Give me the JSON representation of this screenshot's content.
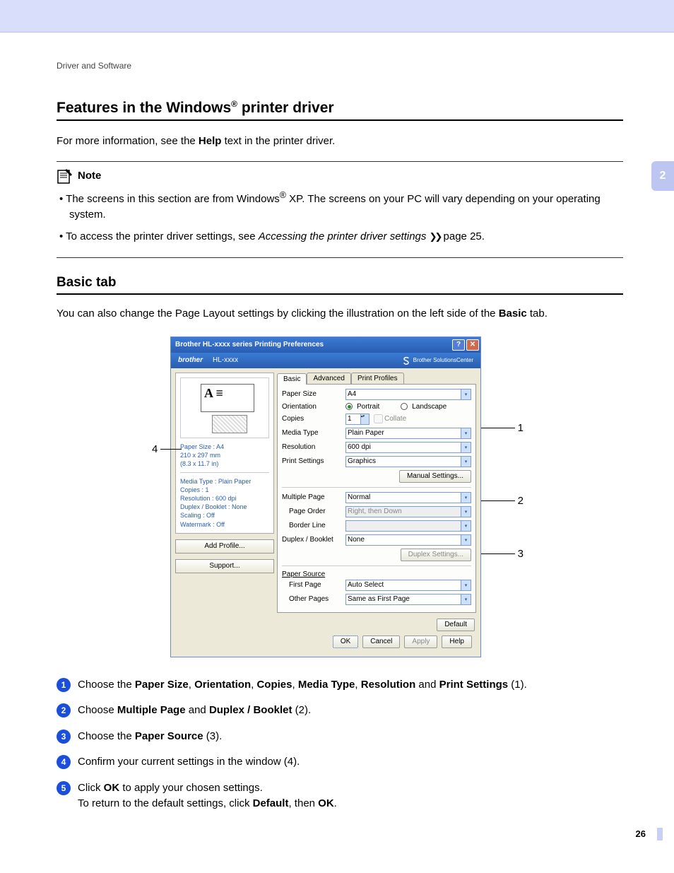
{
  "chapter_tab": "2",
  "breadcrumb": "Driver and Software",
  "heading": "Features in the Windows® printer driver",
  "intro_prefix": "For more information, see the ",
  "intro_bold": "Help",
  "intro_suffix": " text in the printer driver.",
  "note_label": "Note",
  "note1_a": "The screens in this section are from Windows",
  "note1_b": " XP. The screens on your PC will vary depending on your operating system.",
  "note2_a": "To access the printer driver settings, see ",
  "note2_italic": "Accessing the printer driver settings",
  "note2_b": " page 25.",
  "subheading": "Basic tab",
  "sub_intro_a": "You can also change the Page Layout settings by clicking the illustration on the left side of the ",
  "sub_intro_bold": "Basic",
  "sub_intro_b": " tab.",
  "dialog": {
    "title": "Brother HL-xxxx series Printing Preferences",
    "brand": "brother",
    "model": "HL-xxxx",
    "solutions": "Brother SolutionsCenter",
    "tabs": {
      "basic": "Basic",
      "advanced": "Advanced",
      "profiles": "Print Profiles"
    },
    "labels": {
      "paper_size": "Paper Size",
      "orientation": "Orientation",
      "copies": "Copies",
      "media_type": "Media Type",
      "resolution": "Resolution",
      "print_settings": "Print Settings",
      "multiple_page": "Multiple Page",
      "page_order": "Page Order",
      "border_line": "Border Line",
      "duplex_booklet": "Duplex / Booklet",
      "paper_source": "Paper Source",
      "first_page": "First Page",
      "other_pages": "Other Pages"
    },
    "values": {
      "paper_size": "A4",
      "portrait": "Portrait",
      "landscape": "Landscape",
      "copies": "1",
      "collate": "Collate",
      "media_type": "Plain Paper",
      "resolution": "600 dpi",
      "print_settings": "Graphics",
      "multiple_page": "Normal",
      "page_order": "Right, then Down",
      "duplex_booklet": "None",
      "first_page": "Auto Select",
      "other_pages": "Same as First Page"
    },
    "buttons": {
      "manual_settings": "Manual Settings...",
      "duplex_settings": "Duplex Settings...",
      "default": "Default",
      "add_profile": "Add Profile...",
      "support": "Support...",
      "ok": "OK",
      "cancel": "Cancel",
      "apply": "Apply",
      "help": "Help"
    },
    "summary": {
      "l1": "Paper Size : A4",
      "l2": "210 x 297 mm",
      "l3": "(8.3 x 11.7 in)",
      "l4": "Media Type : Plain Paper",
      "l5": "Copies : 1",
      "l6": "Resolution : 600 dpi",
      "l7": "Duplex / Booklet : None",
      "l8": "Scaling : Off",
      "l9": "Watermark : Off"
    }
  },
  "callouts": {
    "c1": "1",
    "c2": "2",
    "c3": "3",
    "c4": "4"
  },
  "steps": {
    "s1": "Choose the <b>Paper Size</b>, <b>Orientation</b>, <b>Copies</b>, <b>Media Type</b>, <b>Resolution</b> and <b>Print Settings</b> (1).",
    "s2": "Choose <b>Multiple Page</b> and <b>Duplex / Booklet</b> (2).",
    "s3": "Choose the <b>Paper Source</b> (3).",
    "s4": "Confirm your current settings in the window (4).",
    "s5": "Click <b>OK</b> to apply your chosen settings.<br>To return to the default settings, click <b>Default</b>, then <b>OK</b>."
  },
  "page_number": "26"
}
